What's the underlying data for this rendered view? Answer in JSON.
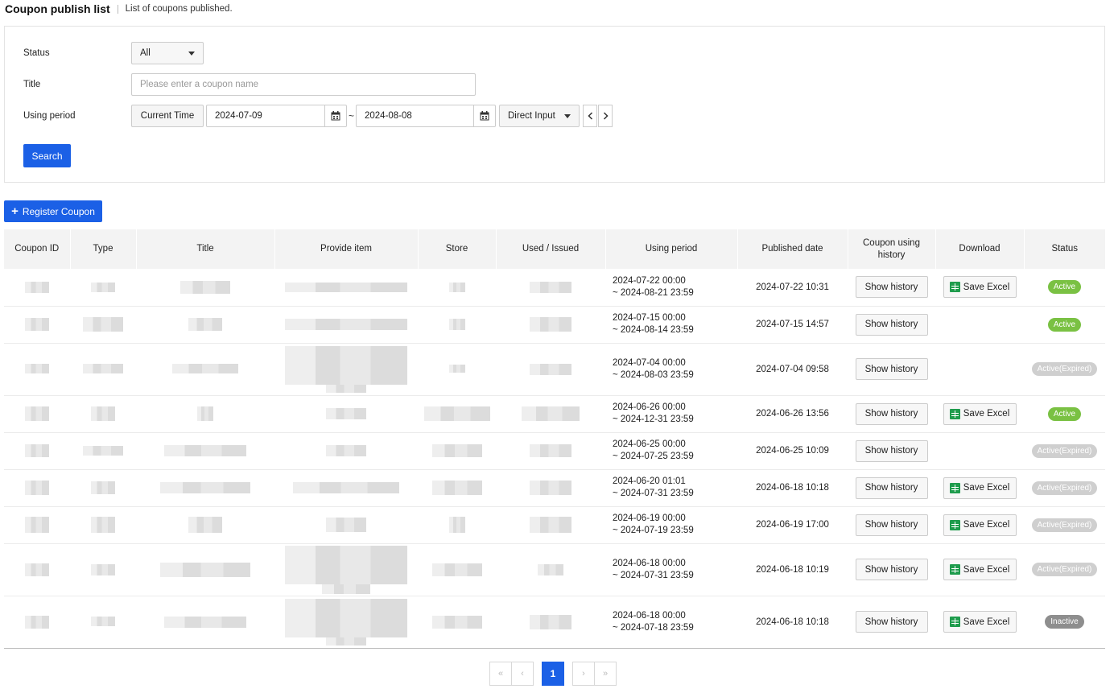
{
  "header": {
    "title": "Coupon publish list",
    "description": "List of coupons published."
  },
  "filters": {
    "status_label": "Status",
    "status_value": "All",
    "title_label": "Title",
    "title_placeholder": "Please enter a coupon name",
    "period_label": "Using period",
    "current_time_label": "Current Time",
    "start_date": "2024-07-09",
    "end_date": "2024-08-08",
    "range_separator": "~",
    "period_mode": "Direct Input",
    "search_label": "Search"
  },
  "register_label": "Register Coupon",
  "table": {
    "columns": [
      "Coupon ID",
      "Type",
      "Title",
      "Provide item",
      "Store",
      "Used / Issued",
      "Using period",
      "Published date",
      "Coupon using history",
      "Download",
      "Status"
    ],
    "history_label": "Show history",
    "excel_label": "Save Excel",
    "rows": [
      {
        "period_start": "2024-07-22 00:00",
        "period_end": "~ 2024-08-21 23:59",
        "published": "2024-07-22 10:31",
        "excel": true,
        "status": "Active"
      },
      {
        "period_start": "2024-07-15 00:00",
        "period_end": "~ 2024-08-14 23:59",
        "published": "2024-07-15 14:57",
        "excel": false,
        "status": "Active"
      },
      {
        "period_start": "2024-07-04 00:00",
        "period_end": "~ 2024-08-03 23:59",
        "published": "2024-07-04 09:58",
        "excel": false,
        "status": "Active(Expired)"
      },
      {
        "period_start": "2024-06-26 00:00",
        "period_end": "~ 2024-12-31 23:59",
        "published": "2024-06-26 13:56",
        "excel": true,
        "status": "Active"
      },
      {
        "period_start": "2024-06-25 00:00",
        "period_end": "~ 2024-07-25 23:59",
        "published": "2024-06-25 10:09",
        "excel": false,
        "status": "Active(Expired)"
      },
      {
        "period_start": "2024-06-20 01:01",
        "period_end": "~ 2024-07-31 23:59",
        "published": "2024-06-18 10:18",
        "excel": true,
        "status": "Active(Expired)"
      },
      {
        "period_start": "2024-06-19 00:00",
        "period_end": "~ 2024-07-19 23:59",
        "published": "2024-06-19 17:00",
        "excel": true,
        "status": "Active(Expired)"
      },
      {
        "period_start": "2024-06-18 00:00",
        "period_end": "~ 2024-07-31 23:59",
        "published": "2024-06-18 10:19",
        "excel": true,
        "status": "Active(Expired)"
      },
      {
        "period_start": "2024-06-18 00:00",
        "period_end": "~ 2024-07-18 23:59",
        "published": "2024-06-18 10:18",
        "excel": true,
        "status": "Inactive"
      }
    ]
  },
  "pagination": {
    "first": "«",
    "prev": "‹",
    "current": "1",
    "next": "›",
    "last": "»"
  },
  "colors": {
    "primary": "#1b60e6",
    "active": "#7ac143",
    "expired": "#cfcfcf",
    "inactive": "#8e8e8e",
    "excel_green": "#1f9c4d"
  },
  "icons": [
    "calendar-icon",
    "chevron-down-icon",
    "chevron-left-icon",
    "chevron-right-icon",
    "plus-icon",
    "spreadsheet-icon"
  ]
}
